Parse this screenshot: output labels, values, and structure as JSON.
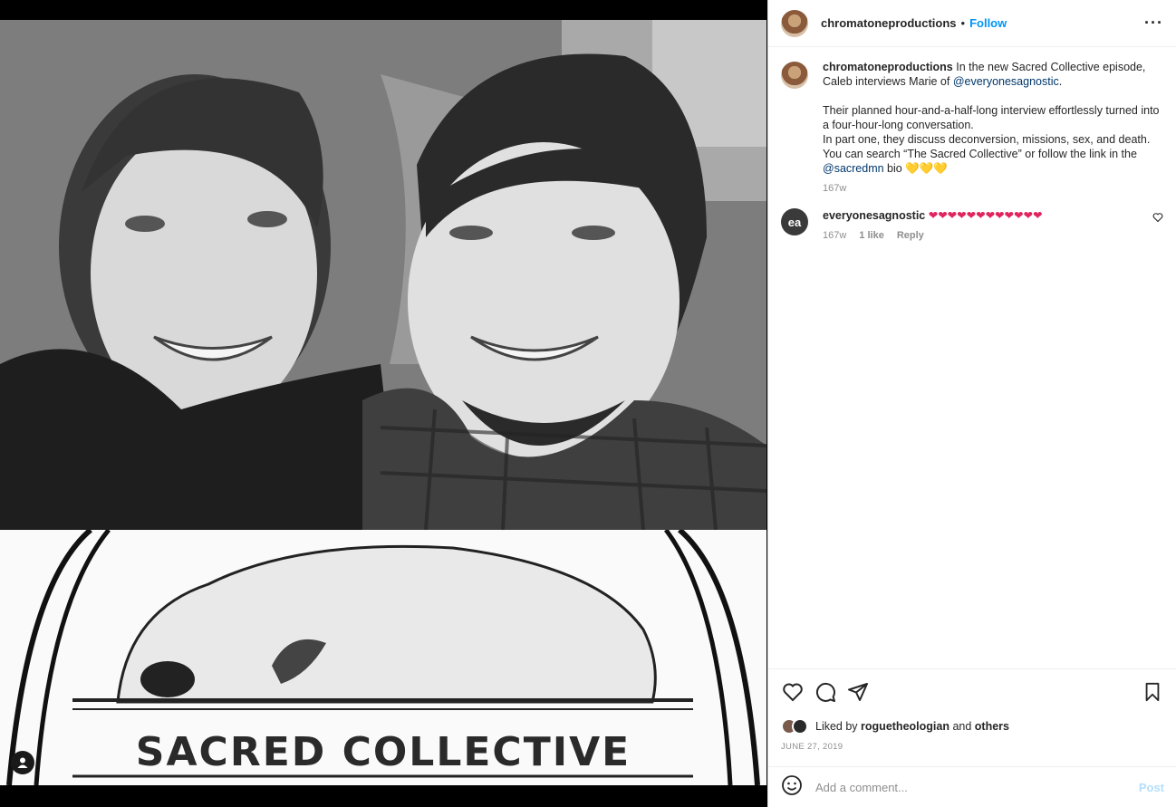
{
  "post": {
    "username": "chromatoneproductions",
    "follow_label": "Follow",
    "separator": "•",
    "more_label": "···"
  },
  "media": {
    "logo_text": "SACRED COLLECTIVE"
  },
  "caption": {
    "username": "chromatoneproductions",
    "line1": "In the new Sacred Collective episode, Caleb interviews Marie of ",
    "mention1": "@everyonesagnostic",
    "line1_end": ".",
    "line2": "Their planned hour-and-a-half-long interview effortlessly turned into a four-hour-long conversation.",
    "line3": "In part one, they discuss deconversion, missions, sex, and death.",
    "line4": "You can search “The Sacred Collective” or follow the link in the ",
    "mention2": "@sacredmn",
    "line4_end": " bio ",
    "emoji": "💛💛💛",
    "time": "167w"
  },
  "comments": [
    {
      "username": "everyonesagnostic",
      "avatar_text": "ea",
      "text": "❤❤❤❤❤❤❤❤❤❤❤❤",
      "time": "167w",
      "likes": "1 like",
      "reply_label": "Reply"
    }
  ],
  "footer": {
    "liked_prefix": "Liked by",
    "liked_user": "roguetheologian",
    "liked_and": "and",
    "liked_others": "others",
    "date": "JUNE 27, 2019",
    "comment_placeholder": "Add a comment...",
    "post_label": "Post"
  },
  "colors": {
    "follow": "#0095f6",
    "mention": "#00376b",
    "heart": "#e0245e",
    "post_disabled": "#b2dffc"
  },
  "icons": [
    "heart-icon",
    "comment-icon",
    "share-icon",
    "save-icon",
    "emoji-icon",
    "user-tag-icon",
    "more-icon"
  ]
}
